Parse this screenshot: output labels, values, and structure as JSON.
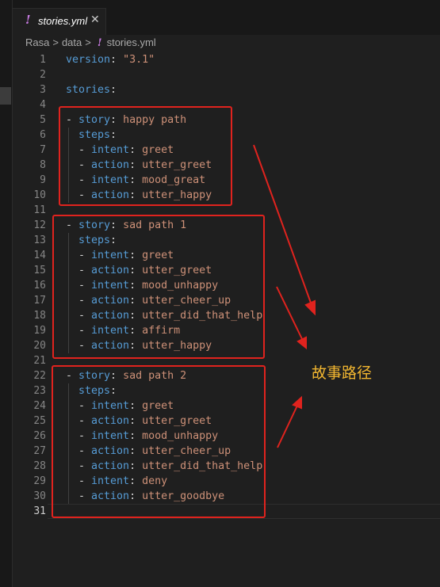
{
  "tab": {
    "icon": "yaml-exclamation-icon",
    "label": "stories.yml",
    "close": "✕"
  },
  "breadcrumb": {
    "items": [
      "Rasa",
      "data"
    ],
    "separator": ">",
    "file_icon": "!",
    "file": "stories.yml"
  },
  "annotation": "故事路径",
  "colors": {
    "highlight": "#e0231e",
    "annotation": "#f2b630",
    "keyword": "#569cd6",
    "string": "#ce9178"
  },
  "code": {
    "lines": [
      {
        "n": "1",
        "indent": "",
        "dash": "",
        "key": "version",
        "colon": ": ",
        "value": "\"3.1\""
      },
      {
        "n": "2",
        "indent": "",
        "dash": "",
        "key": "",
        "colon": "",
        "value": ""
      },
      {
        "n": "3",
        "indent": "",
        "dash": "",
        "key": "stories",
        "colon": ":",
        "value": ""
      },
      {
        "n": "4",
        "indent": "",
        "dash": "",
        "key": "",
        "colon": "",
        "value": ""
      },
      {
        "n": "5",
        "indent": "",
        "dash": "- ",
        "key": "story",
        "colon": ": ",
        "value": "happy path"
      },
      {
        "n": "6",
        "indent": "  ",
        "dash": "",
        "key": "steps",
        "colon": ":",
        "value": ""
      },
      {
        "n": "7",
        "indent": "  ",
        "dash": "- ",
        "key": "intent",
        "colon": ": ",
        "value": "greet"
      },
      {
        "n": "8",
        "indent": "  ",
        "dash": "- ",
        "key": "action",
        "colon": ": ",
        "value": "utter_greet"
      },
      {
        "n": "9",
        "indent": "  ",
        "dash": "- ",
        "key": "intent",
        "colon": ": ",
        "value": "mood_great"
      },
      {
        "n": "10",
        "indent": "  ",
        "dash": "- ",
        "key": "action",
        "colon": ": ",
        "value": "utter_happy"
      },
      {
        "n": "11",
        "indent": "",
        "dash": "",
        "key": "",
        "colon": "",
        "value": ""
      },
      {
        "n": "12",
        "indent": "",
        "dash": "- ",
        "key": "story",
        "colon": ": ",
        "value": "sad path 1"
      },
      {
        "n": "13",
        "indent": "  ",
        "dash": "",
        "key": "steps",
        "colon": ":",
        "value": ""
      },
      {
        "n": "14",
        "indent": "  ",
        "dash": "- ",
        "key": "intent",
        "colon": ": ",
        "value": "greet"
      },
      {
        "n": "15",
        "indent": "  ",
        "dash": "- ",
        "key": "action",
        "colon": ": ",
        "value": "utter_greet"
      },
      {
        "n": "16",
        "indent": "  ",
        "dash": "- ",
        "key": "intent",
        "colon": ": ",
        "value": "mood_unhappy"
      },
      {
        "n": "17",
        "indent": "  ",
        "dash": "- ",
        "key": "action",
        "colon": ": ",
        "value": "utter_cheer_up"
      },
      {
        "n": "18",
        "indent": "  ",
        "dash": "- ",
        "key": "action",
        "colon": ": ",
        "value": "utter_did_that_help"
      },
      {
        "n": "19",
        "indent": "  ",
        "dash": "- ",
        "key": "intent",
        "colon": ": ",
        "value": "affirm"
      },
      {
        "n": "20",
        "indent": "  ",
        "dash": "- ",
        "key": "action",
        "colon": ": ",
        "value": "utter_happy"
      },
      {
        "n": "21",
        "indent": "",
        "dash": "",
        "key": "",
        "colon": "",
        "value": ""
      },
      {
        "n": "22",
        "indent": "",
        "dash": "- ",
        "key": "story",
        "colon": ": ",
        "value": "sad path 2"
      },
      {
        "n": "23",
        "indent": "  ",
        "dash": "",
        "key": "steps",
        "colon": ":",
        "value": ""
      },
      {
        "n": "24",
        "indent": "  ",
        "dash": "- ",
        "key": "intent",
        "colon": ": ",
        "value": "greet"
      },
      {
        "n": "25",
        "indent": "  ",
        "dash": "- ",
        "key": "action",
        "colon": ": ",
        "value": "utter_greet"
      },
      {
        "n": "26",
        "indent": "  ",
        "dash": "- ",
        "key": "intent",
        "colon": ": ",
        "value": "mood_unhappy"
      },
      {
        "n": "27",
        "indent": "  ",
        "dash": "- ",
        "key": "action",
        "colon": ": ",
        "value": "utter_cheer_up"
      },
      {
        "n": "28",
        "indent": "  ",
        "dash": "- ",
        "key": "action",
        "colon": ": ",
        "value": "utter_did_that_help"
      },
      {
        "n": "29",
        "indent": "  ",
        "dash": "- ",
        "key": "intent",
        "colon": ": ",
        "value": "deny"
      },
      {
        "n": "30",
        "indent": "  ",
        "dash": "- ",
        "key": "action",
        "colon": ": ",
        "value": "utter_goodbye"
      },
      {
        "n": "31",
        "indent": "",
        "dash": "",
        "key": "",
        "colon": "",
        "value": ""
      }
    ]
  }
}
